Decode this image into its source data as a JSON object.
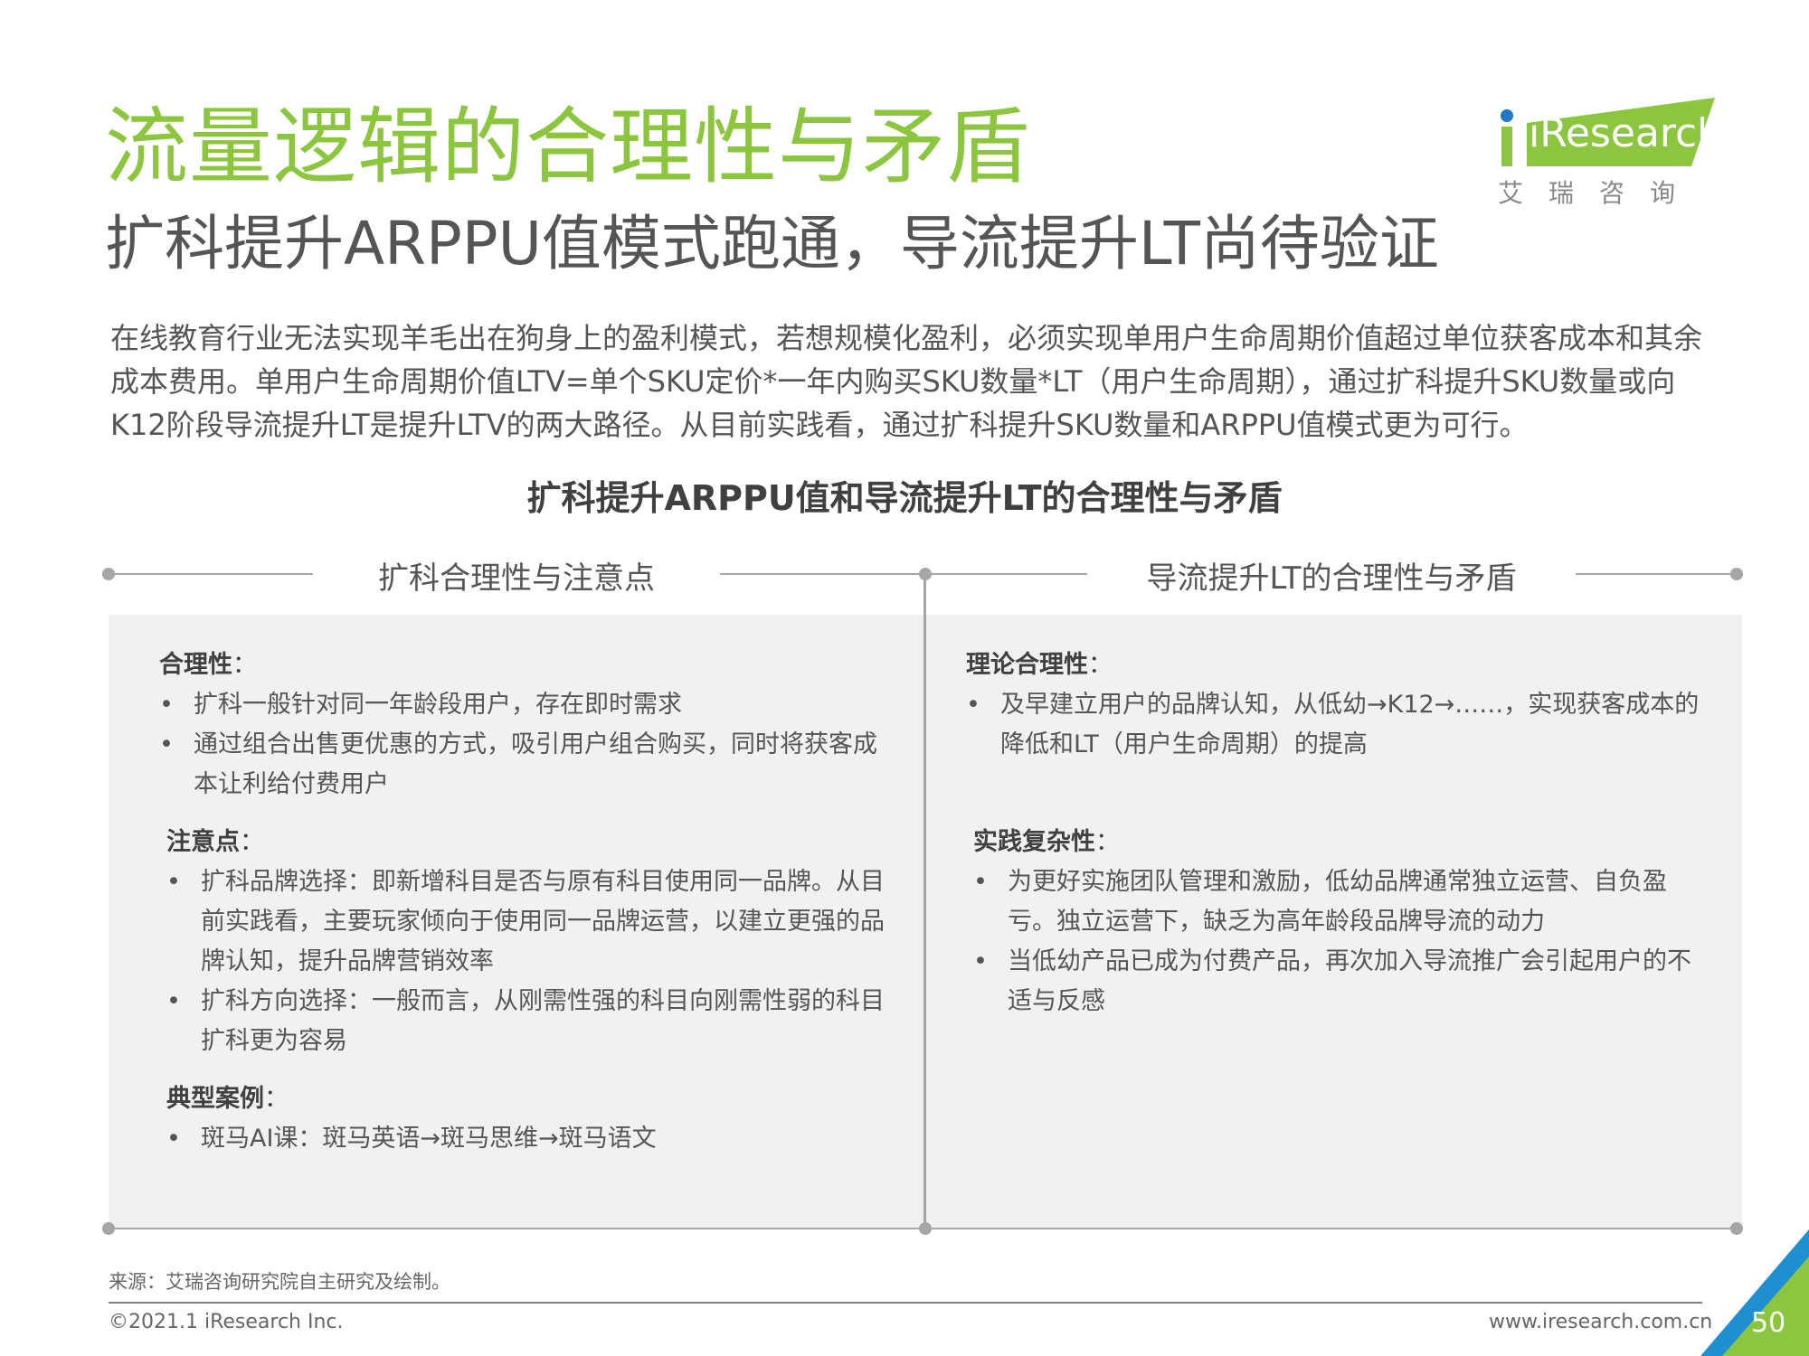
{
  "header": {
    "title": "流量逻辑的合理性与矛盾",
    "subtitle": "扩科提升ARPPU值模式跑通，导流提升LT尚待验证"
  },
  "logo": {
    "text": "iResearch",
    "chinese": "艾瑞咨询",
    "colors": {
      "green": "#8cc63f",
      "blue": "#1f78c8"
    }
  },
  "intro": "在线教育行业无法实现羊毛出在狗身上的盈利模式，若想规模化盈利，必须实现单用户生命周期价值超过单位获客成本和其余成本费用。单用户生命周期价值LTV=单个SKU定价*一年内购买SKU数量*LT（用户生命周期），通过扩科提升SKU数量或向K12阶段导流提升LT是提升LTV的两大路径。从目前实践看，通过扩科提升SKU数量和ARPPU值模式更为可行。",
  "figure_title": "扩科提升ARPPU值和导流提升LT的合理性与矛盾",
  "left_column": {
    "heading": "扩科合理性与注意点",
    "sections": [
      {
        "title": "合理性",
        "colon": "：",
        "items": [
          "扩科一般针对同一年龄段用户，存在即时需求",
          "通过组合出售更优惠的方式，吸引用户组合购买，同时将获客成本让利给付费用户"
        ]
      },
      {
        "title": "注意点",
        "colon": "：",
        "items": [
          "扩科品牌选择：即新增科目是否与原有科目使用同一品牌。从目前实践看，主要玩家倾向于使用同一品牌运营，以建立更强的品牌认知，提升品牌营销效率",
          "扩科方向选择：一般而言，从刚需性强的科目向刚需性弱的科目扩科更为容易"
        ]
      },
      {
        "title": "典型案例",
        "colon": "：",
        "items": [
          "斑马AI课：斑马英语→斑马思维→斑马语文"
        ]
      }
    ]
  },
  "right_column": {
    "heading": "导流提升LT的合理性与矛盾",
    "sections": [
      {
        "title": "理论合理性",
        "colon": "：",
        "items": [
          "及早建立用户的品牌认知，从低幼→K12→……，实现获客成本的降低和LT（用户生命周期）的提高"
        ]
      },
      {
        "title": "实践复杂性",
        "colon": "：",
        "items": [
          "为更好实施团队管理和激励，低幼品牌通常独立运营、自负盈亏。独立运营下，缺乏为高年龄段品牌导流的动力",
          "当低幼产品已成为付费产品，再次加入导流推广会引起用户的不适与反感"
        ]
      }
    ]
  },
  "footer": {
    "source": "来源：艾瑞咨询研究院自主研究及绘制。",
    "copyright": "©2021.1 iResearch Inc.",
    "website": "www.iresearch.com.cn",
    "page_number": "50"
  },
  "colors": {
    "title_green": "#8cc63f",
    "text_gray": "#555555",
    "panel_bg": "#f1f1f1",
    "line_gray": "#a6a6a6"
  }
}
